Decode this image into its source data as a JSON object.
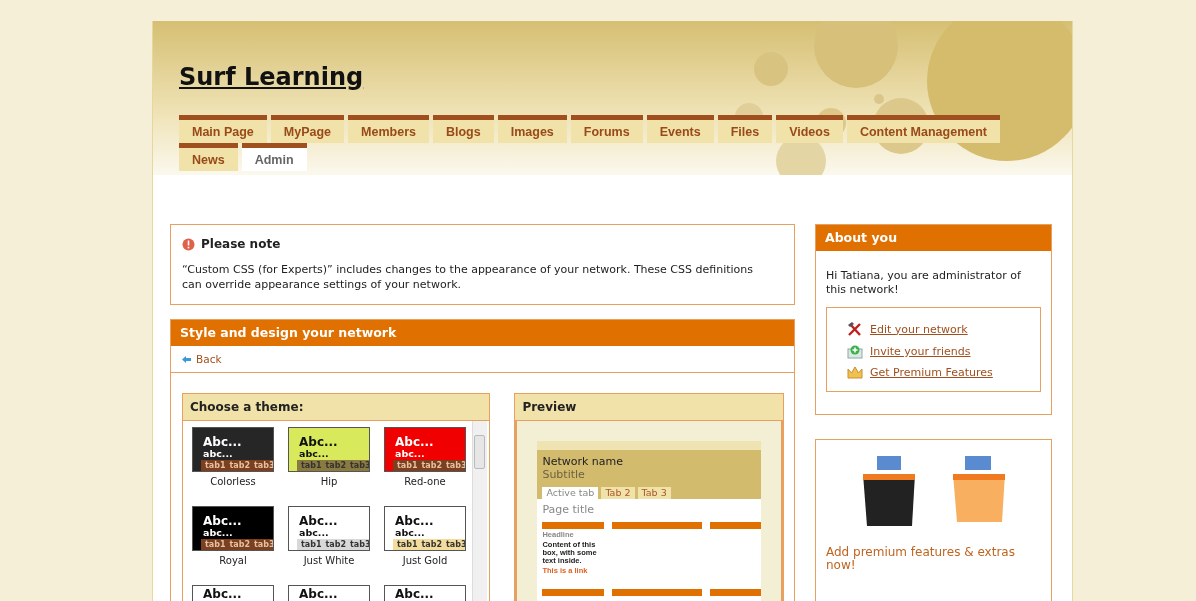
{
  "site": {
    "title": "Surf Learning"
  },
  "tabs": [
    {
      "label": "Main Page",
      "selected": false
    },
    {
      "label": "MyPage",
      "selected": false
    },
    {
      "label": "Members",
      "selected": false
    },
    {
      "label": "Blogs",
      "selected": false
    },
    {
      "label": "Images",
      "selected": false
    },
    {
      "label": "Forums",
      "selected": false
    },
    {
      "label": "Events",
      "selected": false
    },
    {
      "label": "Files",
      "selected": false
    },
    {
      "label": "Videos",
      "selected": false
    },
    {
      "label": "Content Management",
      "selected": false
    },
    {
      "label": "News",
      "selected": false
    },
    {
      "label": "Admin",
      "selected": true
    }
  ],
  "note": {
    "title": "Please note",
    "text": "“Custom CSS (for Experts)” includes changes to the appearance of your network. These CSS definitions can override appearance settings of your network."
  },
  "style_panel": {
    "title": "Style and design your network",
    "back": "Back",
    "themes_title": "Choose a theme:",
    "themes": [
      {
        "name": "Colorless",
        "heading": "Abc...",
        "subheading": "abc...",
        "tabs": [
          "tab1",
          "tab2",
          "tab3"
        ],
        "color": "#262626"
      },
      {
        "name": "Hip",
        "heading": "Abc...",
        "subheading": "abc...",
        "tabs": [
          "tab1",
          "tab2",
          "tab3"
        ],
        "color": "#d8ea5c"
      },
      {
        "name": "Red-one",
        "heading": "Abc...",
        "subheading": "abc...",
        "tabs": [
          "tab1",
          "tab2",
          "tab3"
        ],
        "color": "#f00000"
      },
      {
        "name": "Royal",
        "heading": "Abc...",
        "subheading": "abc...",
        "tabs": [
          "tab1",
          "tab2",
          "tab3"
        ],
        "color": "#000000"
      },
      {
        "name": "Just White",
        "heading": "Abc...",
        "subheading": "abc...",
        "tabs": [
          "tab1",
          "tab2",
          "tab3"
        ],
        "color": "#ffffff"
      },
      {
        "name": "Just Gold",
        "heading": "Abc...",
        "subheading": "abc...",
        "tabs": [
          "tab1",
          "tab2",
          "tab3"
        ],
        "color": "#f3dc9c"
      },
      {
        "heading": "Abc...",
        "color": "#ffffff"
      },
      {
        "heading": "Abc...",
        "color": "#ffffff"
      },
      {
        "heading": "Abc...",
        "color": "#ffffff"
      }
    ],
    "preview": {
      "title": "Preview",
      "network_name": "Network name",
      "subtitle": "Subtitle",
      "tabs": [
        {
          "label": "Active tab",
          "selected": true
        },
        {
          "label": "Tab 2",
          "selected": false
        },
        {
          "label": "Tab 3",
          "selected": false
        }
      ],
      "page_title": "Page title",
      "box_headline": "Headline",
      "box_text": "Content of this box, with some text inside.",
      "box_link": "This is a link"
    }
  },
  "about": {
    "title": "About you",
    "text": "Hi Tatiana, you are administrator of this network!",
    "links": [
      {
        "kind": "tools",
        "label": "Edit your network"
      },
      {
        "kind": "invite",
        "label": "Invite your friends"
      },
      {
        "kind": "crown",
        "label": "Get Premium Features"
      }
    ]
  },
  "premium": {
    "text": "Add premium features & extras now!"
  }
}
